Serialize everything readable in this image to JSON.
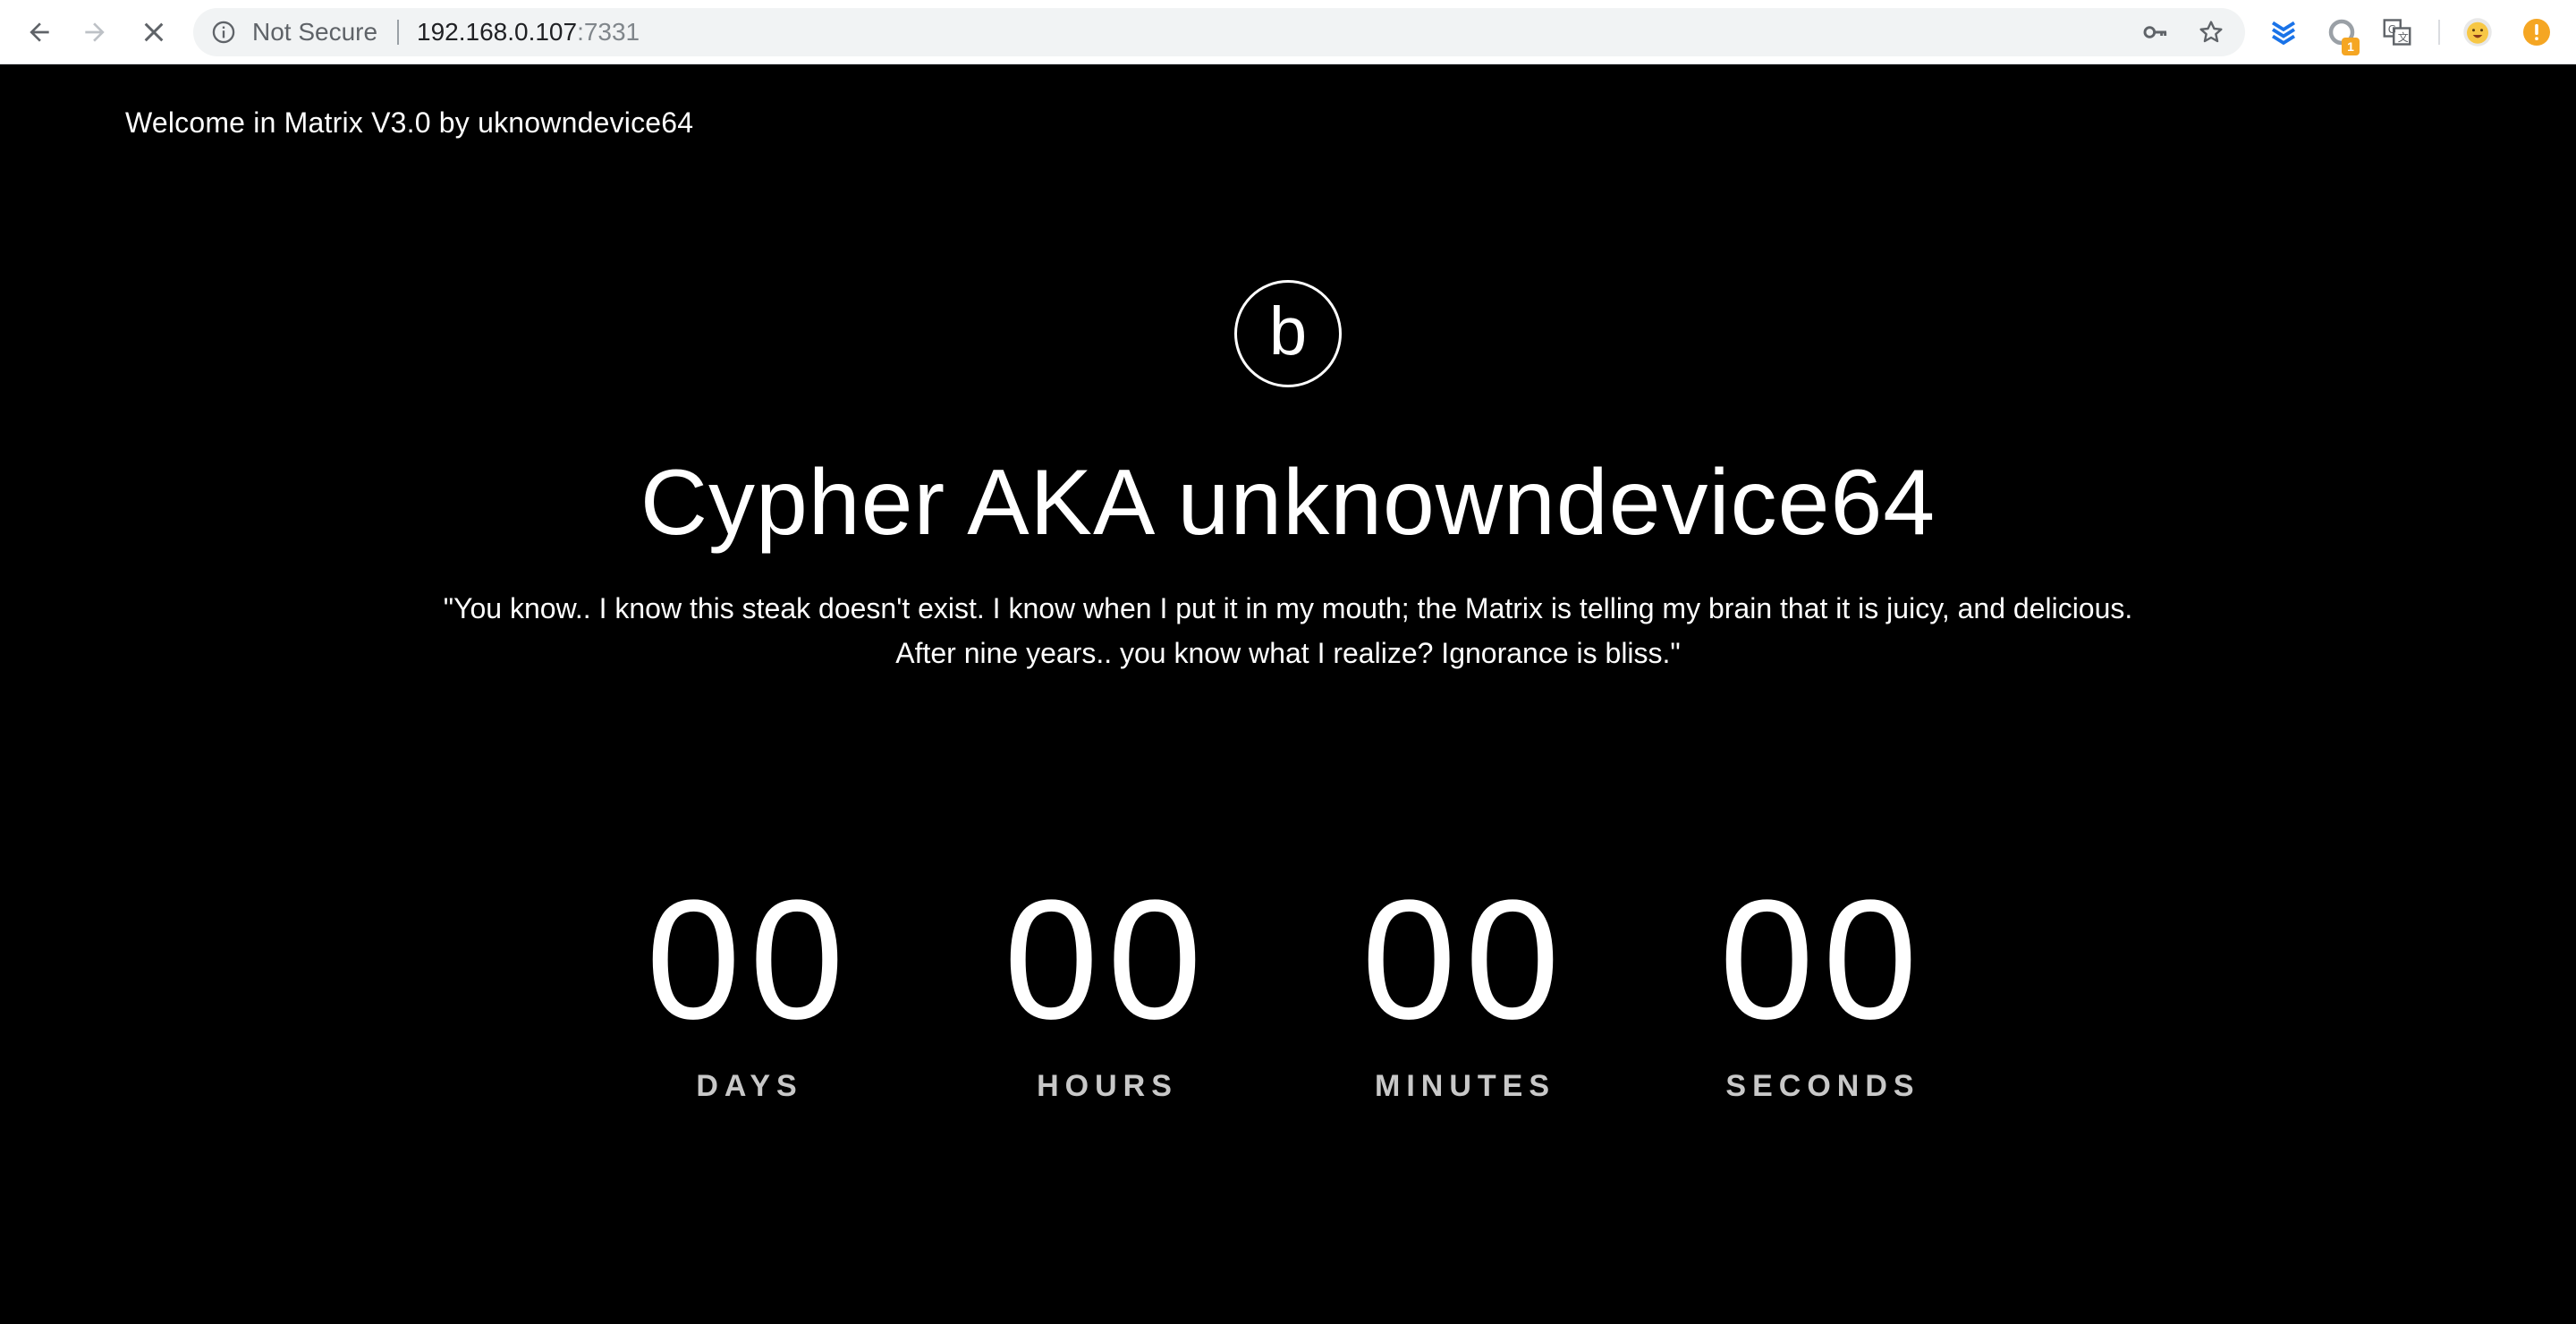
{
  "browser": {
    "security_label": "Not Secure",
    "url_host": "192.168.0.107",
    "url_port": ":7331",
    "extension_badge": "1",
    "icons": {
      "back": "back-arrow-icon",
      "forward": "forward-arrow-icon",
      "stop": "stop-loading-icon",
      "info": "info-icon",
      "key": "key-icon",
      "bookmark": "star-icon",
      "ext1": "stack-extension-icon",
      "ext2": "loading-extension-icon",
      "ext3": "translate-icon",
      "profile": "avatar-emoji-icon",
      "alert": "warning-icon"
    }
  },
  "page": {
    "welcome": "Welcome in Matrix V3.0 by uknowndevice64",
    "logo_letter": "b",
    "headline": "Cypher AKA unknowndevice64",
    "quote_line1": "\"You know.. I know this steak doesn't exist. I know when I put it in my mouth; the Matrix is telling my brain that it is juicy, and delicious.",
    "quote_line2": "After nine years.. you know what I realize? Ignorance is bliss.\""
  },
  "countdown": {
    "days": {
      "value": "00",
      "label": "DAYS"
    },
    "hours": {
      "value": "00",
      "label": "HOURS"
    },
    "minutes": {
      "value": "00",
      "label": "MINUTES"
    },
    "seconds": {
      "value": "00",
      "label": "SECONDS"
    }
  },
  "colors": {
    "page_background": "#000000",
    "text": "#ffffff",
    "countdown_label": "#c8c8c8",
    "omnibox_background": "#f1f3f4",
    "badge": "#f5a623",
    "alert": "#f5a623",
    "extension_blue": "#1a73e8"
  }
}
